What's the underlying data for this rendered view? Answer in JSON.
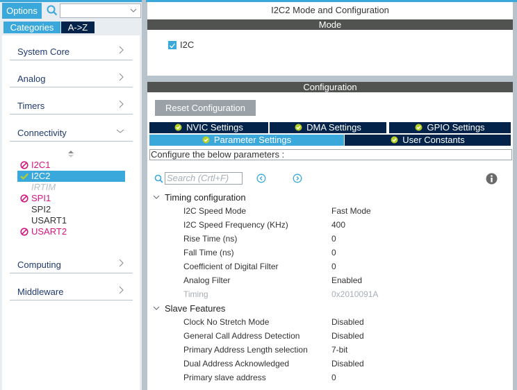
{
  "left": {
    "options_label": "Options",
    "search_value": "",
    "tabs": [
      {
        "label": "Categories",
        "active": true
      },
      {
        "label": "A->Z",
        "active": false
      }
    ],
    "categories": [
      {
        "label": "System Core",
        "expanded": false
      },
      {
        "label": "Analog",
        "expanded": false
      },
      {
        "label": "Timers",
        "expanded": false
      },
      {
        "label": "Connectivity",
        "expanded": true
      },
      {
        "label": "Computing",
        "expanded": false
      },
      {
        "label": "Middleware",
        "expanded": false
      }
    ],
    "peripherals": [
      {
        "label": "I2C1",
        "status": "conflict"
      },
      {
        "label": "I2C2",
        "status": "ok",
        "selected": true
      },
      {
        "label": "IRTIM",
        "status": "disabled"
      },
      {
        "label": "SPI1",
        "status": "conflict"
      },
      {
        "label": "SPI2",
        "status": "none"
      },
      {
        "label": "USART1",
        "status": "none"
      },
      {
        "label": "USART2",
        "status": "conflict"
      }
    ]
  },
  "mode_panel": {
    "title": "I2C2 Mode and Configuration",
    "section_label": "Mode",
    "checkbox_label": "I2C",
    "checkbox_checked": true
  },
  "config_panel": {
    "section_label": "Configuration",
    "reset_label": "Reset Configuration",
    "tabs_row1": [
      "NVIC Settings",
      "DMA Settings",
      "GPIO Settings"
    ],
    "tabs_row2": [
      "Parameter Settings",
      "User Constants"
    ],
    "active_tab": "Parameter Settings",
    "description": "Configure the below parameters :",
    "search_placeholder": "Search (Crtl+F)",
    "groups": [
      {
        "label": "Timing configuration",
        "params": [
          {
            "name": "I2C Speed Mode",
            "value": "Fast Mode"
          },
          {
            "name": "I2C Speed Frequency (KHz)",
            "value": "400"
          },
          {
            "name": "Rise Time (ns)",
            "value": "0"
          },
          {
            "name": "Fall Time (ns)",
            "value": "0"
          },
          {
            "name": "Coefficient of Digital Filter",
            "value": "0"
          },
          {
            "name": "Analog Filter",
            "value": "Enabled"
          },
          {
            "name": "Timing",
            "value": "0x2010091A",
            "readonly": true
          }
        ]
      },
      {
        "label": "Slave Features",
        "params": [
          {
            "name": "Clock No Stretch Mode",
            "value": "Disabled"
          },
          {
            "name": "General Call Address Detection",
            "value": "Disabled"
          },
          {
            "name": "Primary Address Length selection",
            "value": "7-bit"
          },
          {
            "name": "Dual Address Acknowledged",
            "value": "Disabled"
          },
          {
            "name": "Primary slave address",
            "value": "0"
          }
        ]
      }
    ]
  },
  "colors": {
    "accent": "#3ba8dc",
    "navy": "#03234b",
    "section_bar": "#515351",
    "error": "#d4157e",
    "ok_green": "#b6cf2a"
  }
}
